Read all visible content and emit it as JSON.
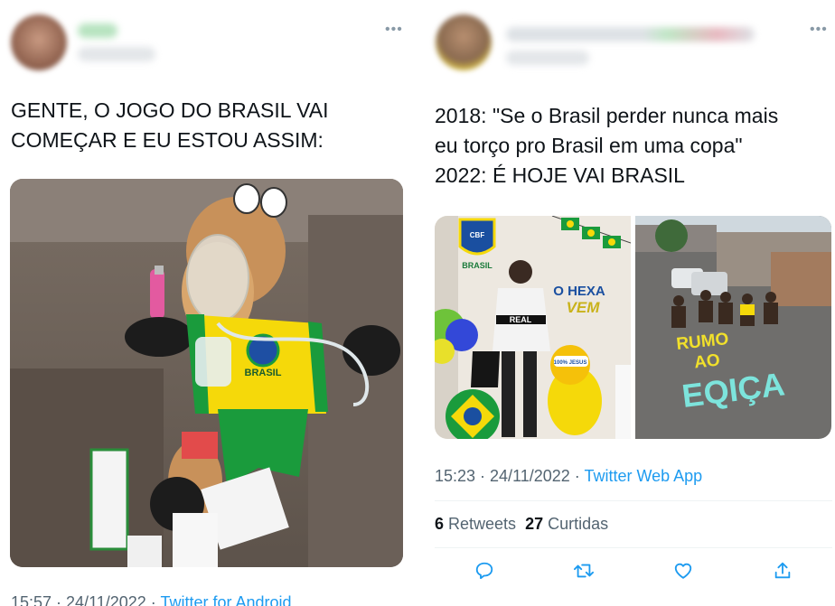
{
  "left_tweet": {
    "text": "GENTE, O JOGO DO BRASIL VAI\nCOMEÇAR E EU ESTOU ASSIM:",
    "timestamp": "15:57 · 24/11/2022 · ",
    "app": "Twitter for Android",
    "photo": {
      "shirt_text": "BRASIL"
    }
  },
  "right_tweet": {
    "text": "2018: \"Se o Brasil perder nunca mais\neu torço pro Brasil em uma copa\"\n2022: É HOJE VAI BRASIL",
    "timestamp": "15:23 · 24/11/2022 · ",
    "app": "Twitter Web App",
    "retweets_count": "6",
    "retweets_label": " Retweets  ",
    "likes_count": "27",
    "likes_label": " Curtidas",
    "photo1": {
      "cbf": "CBF",
      "brasil": "BRASIL",
      "o_hexa": "O HEXA",
      "vem": "VEM",
      "shirt": "REAL",
      "jesus": "100% JESUS"
    },
    "photo2": {
      "line1": "RUMO",
      "line2": "AO",
      "line3": "EQIÇA"
    }
  },
  "colors": {
    "link": "#1d9bf0",
    "muted": "#536471",
    "brazil_green": "#1a9b3c",
    "brazil_yellow": "#f5d90a"
  },
  "icons": [
    "more-icon",
    "reply-icon",
    "retweet-icon",
    "like-icon",
    "share-icon"
  ]
}
